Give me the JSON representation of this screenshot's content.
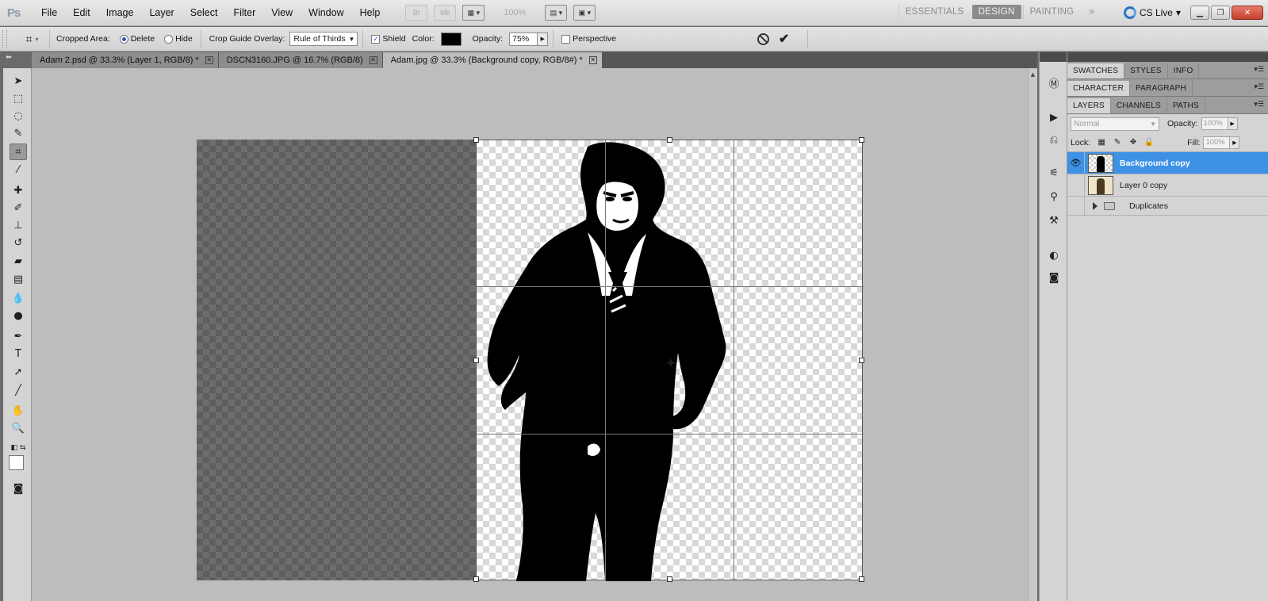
{
  "app": {
    "logo": "Ps"
  },
  "menu": [
    "File",
    "Edit",
    "Image",
    "Layer",
    "Select",
    "Filter",
    "View",
    "Window",
    "Help"
  ],
  "app_bar": {
    "bridge": "Br",
    "minibridge": "Mb",
    "zoom": "100%"
  },
  "workspaces": {
    "essentials": "ESSENTIALS",
    "design": "DESIGN",
    "painting": "PAINTING",
    "more": "»",
    "active": "DESIGN"
  },
  "cs_live": "CS Live",
  "options": {
    "cropped_area_label": "Cropped Area:",
    "delete_label": "Delete",
    "hide_label": "Hide",
    "cropped_area_value": "Delete",
    "guide_overlay_label": "Crop Guide Overlay:",
    "guide_overlay_value": "Rule of Thirds",
    "shield_label": "Shield",
    "shield_checked": true,
    "color_label": "Color:",
    "shield_color": "#000000",
    "opacity_label": "Opacity:",
    "opacity_value": "75%",
    "perspective_label": "Perspective",
    "perspective_checked": false
  },
  "tabs": [
    {
      "label": "Adam 2.psd @ 33.3% (Layer 1, RGB/8) *",
      "active": false
    },
    {
      "label": "DSCN3160.JPG @ 16.7% (RGB/8)",
      "active": false
    },
    {
      "label": "Adam.jpg @ 33.3% (Background copy, RGB/8#) *",
      "active": true
    }
  ],
  "panels": {
    "group1_tabs": [
      "SWATCHES",
      "STYLES",
      "INFO"
    ],
    "group2_tabs": [
      "CHARACTER",
      "PARAGRAPH"
    ],
    "group3_tabs": [
      "LAYERS",
      "CHANNELS",
      "PATHS"
    ],
    "blend_mode": "Normal",
    "opacity_label": "Opacity:",
    "opacity_value": "100%",
    "lock_label": "Lock:",
    "fill_label": "Fill:",
    "fill_value": "100%"
  },
  "layers": [
    {
      "name": "Background copy",
      "visible": true,
      "selected": true
    },
    {
      "name": "Layer 0 copy",
      "visible": false,
      "selected": false
    },
    {
      "name": "Duplicates",
      "visible": false,
      "selected": false,
      "type": "group"
    }
  ],
  "colors": {
    "selection_blue": "#3d92e6",
    "crop_shield": "#000000",
    "workspace_active": "#8b8b8b"
  },
  "icons": {
    "tools": [
      "move-icon",
      "marquee-icon",
      "lasso-icon",
      "quick-select-icon",
      "crop-icon",
      "eyedropper-icon",
      "healing-brush-icon",
      "brush-icon",
      "clone-stamp-icon",
      "history-brush-icon",
      "eraser-icon",
      "gradient-icon",
      "blur-icon",
      "dodge-icon",
      "pen-icon",
      "type-icon",
      "path-select-icon",
      "line-icon",
      "hand-icon",
      "zoom-icon"
    ]
  }
}
